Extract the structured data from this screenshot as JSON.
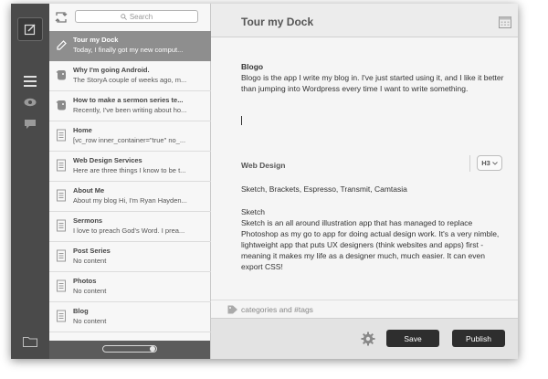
{
  "search": {
    "placeholder": "Search"
  },
  "posts": [
    {
      "title": "Tour my Dock",
      "excerpt": "Today, I finally got my new comput...",
      "icon": "pencil-icon",
      "active": true
    },
    {
      "title": "Why I'm going Android.",
      "excerpt": "The StoryA couple of weeks ago, m...",
      "icon": "evernote-icon",
      "active": false
    },
    {
      "title": "How to make a sermon series te...",
      "excerpt": "Recently, I've been writing about ho...",
      "icon": "evernote-icon",
      "active": false
    },
    {
      "title": "Home",
      "excerpt": "[vc_row inner_container=\"true\" no_...",
      "icon": "document-icon",
      "active": false
    },
    {
      "title": "Web Design Services",
      "excerpt": " Here are three things I know to be t...",
      "icon": "document-icon",
      "active": false
    },
    {
      "title": "About Me",
      "excerpt": "About my blog Hi, I'm Ryan Hayden...",
      "icon": "document-icon",
      "active": false
    },
    {
      "title": "Sermons",
      "excerpt": "I love to preach God's Word.  I prea...",
      "icon": "document-icon",
      "active": false
    },
    {
      "title": "Post Series",
      "excerpt": "No content",
      "icon": "document-icon",
      "active": false
    },
    {
      "title": "Photos",
      "excerpt": "No content",
      "icon": "document-icon",
      "active": false
    },
    {
      "title": "Blog",
      "excerpt": "No content",
      "icon": "document-icon",
      "active": false
    }
  ],
  "editor": {
    "title": "Tour my Dock",
    "blogo_heading": "Blogo",
    "blogo_text": "Blogo is the app I write my blog in.  I've just started using it, and I like it better than jumping into Wordpress every time I want to write something.",
    "webdesign_heading": "Web Design",
    "heading_level": "H3",
    "tools_line": "Sketch, Brackets, Espresso, Transmit, Camtasia",
    "sketch_heading": "Sketch",
    "sketch_text": "Sketch is an all around illustration app that has managed to replace Photoshop as my go to app for doing actual design work.  It's a very nimble, lightweight app that puts UX designers (think websites and apps) first - meaning it makes my life as a designer much, much easier.  It can even export CSS!",
    "tags_placeholder": "categories and #tags"
  },
  "footer": {
    "save_label": "Save",
    "publish_label": "Publish"
  },
  "colors": {
    "rail": "#4a4a4a",
    "active_item": "#8e8e8e",
    "button": "#2e2e2e"
  }
}
